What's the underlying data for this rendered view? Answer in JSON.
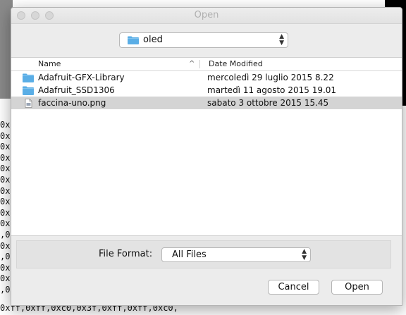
{
  "dialog": {
    "title": "Open",
    "current_folder": "oled",
    "columns": {
      "name": "Name",
      "date": "Date Modified"
    },
    "files": [
      {
        "name": "Adafruit-GFX-Library",
        "date": "mercoledì 29 luglio 2015 8.22",
        "type": "folder"
      },
      {
        "name": "Adafruit_SSD1306",
        "date": "martedì 11 agosto 2015 19.01",
        "type": "folder"
      },
      {
        "name": "faccina-uno.png",
        "date": "sabato 3 ottobre 2015 15.45",
        "type": "file",
        "selected": true
      }
    ],
    "file_format": {
      "label": "File Format:",
      "value": "All Files"
    },
    "buttons": {
      "cancel": "Cancel",
      "open": "Open"
    }
  },
  "background": {
    "code_fragments": [
      "0x",
      "0x",
      "0x",
      "0x",
      "0x",
      "0x",
      "0x",
      "0x",
      "0x",
      "0x",
      ",0",
      "0x",
      ",0",
      "0x",
      "0x",
      ",0"
    ],
    "bottom_code": "0xff,0xff,0xc0,0x3f,0xff,0xff,0xc0,"
  },
  "colors": {
    "folder_icon": "#5aaee6",
    "selected_row": "#d4d4d4",
    "dialog_bg": "#ececec"
  },
  "icons": {
    "folder": "folder-icon",
    "file": "image-file-icon",
    "sort": "sort-ascending-icon",
    "select_arrows": "updown-chevron-icon"
  }
}
